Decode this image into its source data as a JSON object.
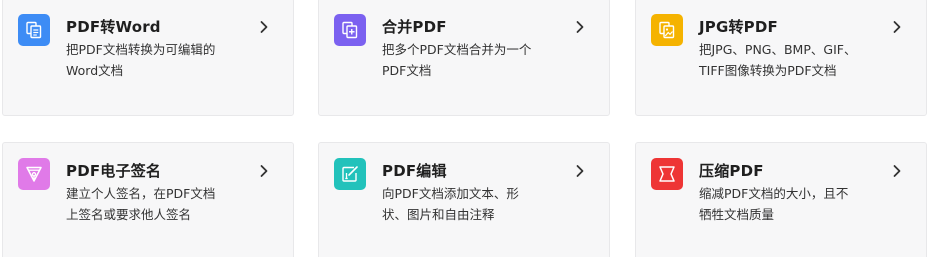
{
  "colors": {
    "blue": "#3d8cf5",
    "purple": "#7b61f0",
    "yellow": "#f5b300",
    "pink": "#e07ae8",
    "teal": "#22c2bb",
    "red": "#ee3535"
  },
  "cards": [
    {
      "title": "PDF转Word",
      "desc_lines": [
        "把PDF文档转换为可编辑的",
        "Word文档"
      ],
      "icon": "pdf-to-word-icon"
    },
    {
      "title": "合并PDF",
      "desc_lines": [
        "把多个PDF文档合并为一个",
        "PDF文档"
      ],
      "icon": "merge-pdf-icon"
    },
    {
      "title": "JPG转PDF",
      "desc_lines": [
        "把JPG、PNG、BMP、GIF、",
        "TIFF图像转换为PDF文档"
      ],
      "icon": "jpg-to-pdf-icon"
    },
    {
      "title": "PDF电子签名",
      "desc_lines": [
        "建立个人签名，在PDF文档",
        "上签名或要求他人签名"
      ],
      "icon": "pen-nib-icon"
    },
    {
      "title": "PDF编辑",
      "desc_lines": [
        "向PDF文档添加文本、形",
        "状、图片和自由注释"
      ],
      "icon": "edit-pdf-icon"
    },
    {
      "title": "压缩PDF",
      "desc_lines": [
        "缩减PDF文档的大小，且不",
        "牺牲文档质量"
      ],
      "icon": "compress-pdf-icon"
    }
  ]
}
